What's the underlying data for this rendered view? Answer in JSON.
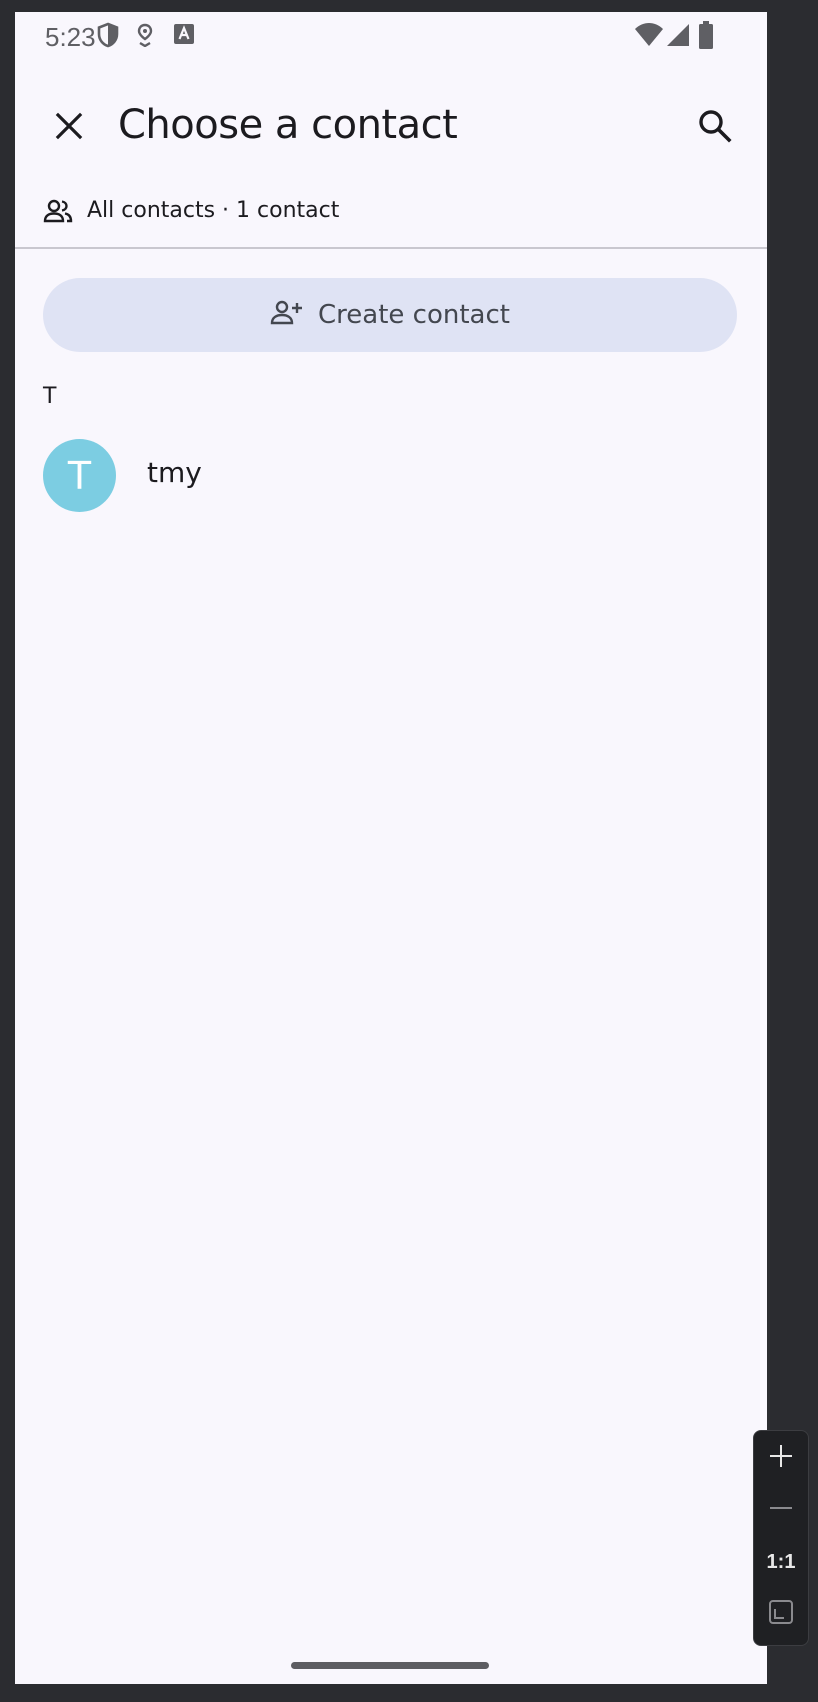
{
  "status_bar": {
    "time": "5:23",
    "left_icons": [
      "shield-icon",
      "location-pin-icon",
      "a-badge-icon"
    ],
    "right_icons": [
      "wifi-icon",
      "cell-signal-icon",
      "battery-icon"
    ]
  },
  "app_bar": {
    "title": "Choose a contact",
    "close_icon": "close-icon",
    "search_icon": "search-icon"
  },
  "filter": {
    "icon": "people-icon",
    "label": "All contacts · 1 contact"
  },
  "create_button": {
    "icon": "add-person-icon",
    "label": "Create contact"
  },
  "sections": [
    {
      "header": "T",
      "contacts": [
        {
          "initial": "T",
          "name": "tmy",
          "avatar_color": "#7ccde2"
        }
      ]
    }
  ],
  "zoom_controls": {
    "ratio_label": "1:1",
    "icons": [
      "plus-icon",
      "minus-icon",
      "fit-screen-icon"
    ]
  },
  "colors": {
    "background": "#f9f7fd",
    "button_tonal": "#dfe3f4",
    "avatar": "#7ccde2",
    "frame": "#2b2c30"
  }
}
